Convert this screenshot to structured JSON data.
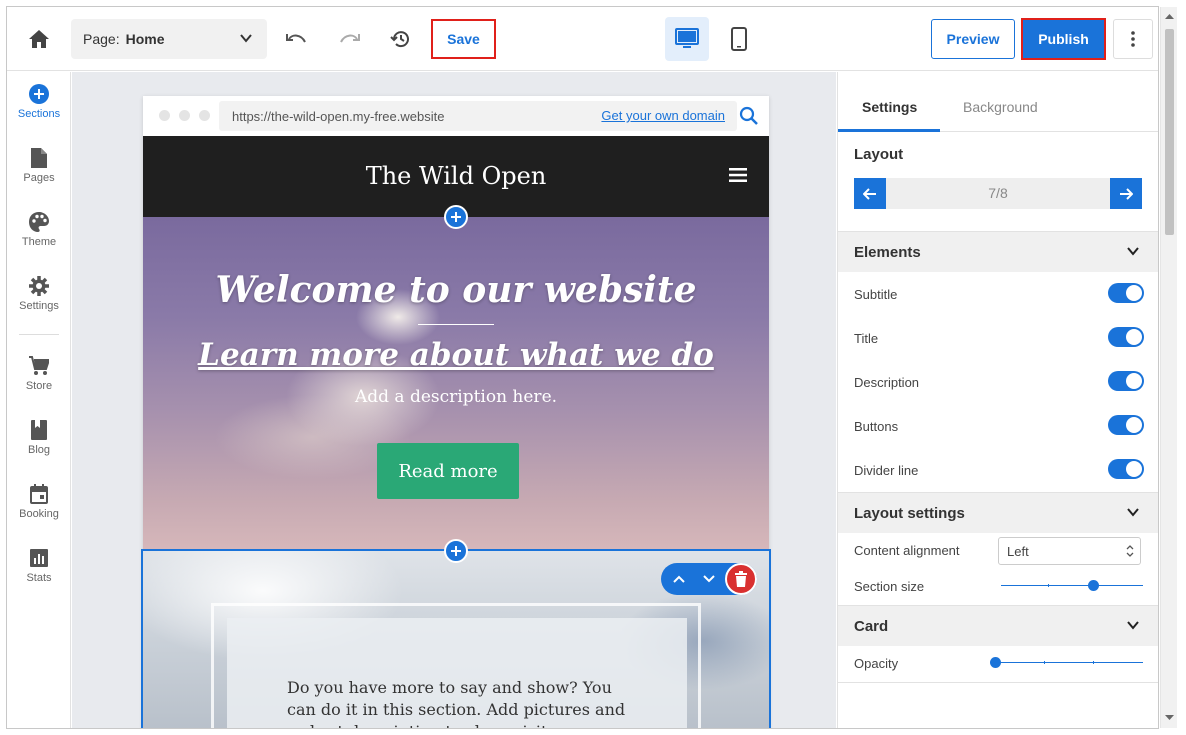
{
  "toolbar": {
    "page_prefix": "Page:",
    "page_value": "Home",
    "save_label": "Save",
    "preview_label": "Preview",
    "publish_label": "Publish",
    "icons": [
      "home-icon",
      "chevron-down-icon",
      "undo-icon",
      "redo-icon",
      "history-icon",
      "desktop-icon",
      "mobile-icon",
      "more-vertical-icon"
    ]
  },
  "sidebar": {
    "items": [
      {
        "label": "Sections",
        "icon": "plus-circle-icon",
        "active": true
      },
      {
        "label": "Pages",
        "icon": "page-icon"
      },
      {
        "label": "Theme",
        "icon": "palette-icon"
      },
      {
        "label": "Settings",
        "icon": "gear-icon"
      },
      {
        "label": "Store",
        "icon": "cart-icon"
      },
      {
        "label": "Blog",
        "icon": "book-icon"
      },
      {
        "label": "Booking",
        "icon": "calendar-icon"
      },
      {
        "label": "Stats",
        "icon": "chart-icon"
      }
    ]
  },
  "browser": {
    "url": "https://the-wild-open.my-free.website",
    "domain_link": "Get your own domain"
  },
  "site": {
    "title": "The Wild Open",
    "hero": {
      "title": "Welcome to our website",
      "subtitle": "Learn more about what we do",
      "description": "Add a description here.",
      "button": "Read more"
    },
    "section2": {
      "text": "Do you have more to say and show? You can do it in this section. Add pictures and a short description to show visit"
    }
  },
  "panel": {
    "tabs": [
      "Settings",
      "Background"
    ],
    "layout": {
      "heading": "Layout",
      "value": "7/8"
    },
    "elements": {
      "heading": "Elements",
      "items": [
        {
          "label": "Subtitle",
          "on": true
        },
        {
          "label": "Title",
          "on": true
        },
        {
          "label": "Description",
          "on": true
        },
        {
          "label": "Buttons",
          "on": true
        },
        {
          "label": "Divider line",
          "on": true
        }
      ]
    },
    "layout_settings": {
      "heading": "Layout settings",
      "alignment_label": "Content alignment",
      "alignment_value": "Left",
      "size_label": "Section size",
      "size_level": 0.65
    },
    "card": {
      "heading": "Card",
      "opacity_label": "Opacity",
      "opacity_level": 0.0
    }
  },
  "colors": {
    "accent": "#1a73d9",
    "highlight_border": "#e0201a",
    "button_green": "#2aa876",
    "delete_red": "#d93030"
  }
}
